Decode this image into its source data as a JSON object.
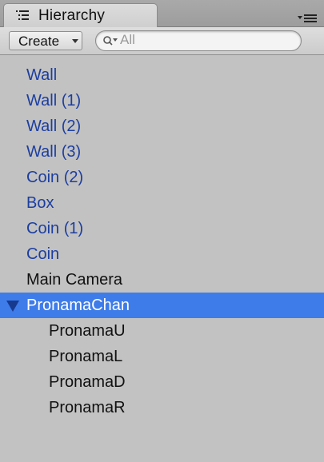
{
  "panel": {
    "tab_title": "Hierarchy",
    "tab_icon": "hierarchy-list-icon",
    "menu_icon": "panel-menu-icon"
  },
  "toolbar": {
    "create_label": "Create",
    "search_placeholder": "All",
    "search_icon": "search-dropdown-icon"
  },
  "tree": {
    "items": [
      {
        "label": "Wall",
        "kind": "prefab",
        "depth": 0
      },
      {
        "label": "Wall (1)",
        "kind": "prefab",
        "depth": 0
      },
      {
        "label": "Wall (2)",
        "kind": "prefab",
        "depth": 0
      },
      {
        "label": "Wall (3)",
        "kind": "prefab",
        "depth": 0
      },
      {
        "label": "Coin (2)",
        "kind": "prefab",
        "depth": 0
      },
      {
        "label": "Box",
        "kind": "prefab",
        "depth": 0
      },
      {
        "label": "Coin (1)",
        "kind": "prefab",
        "depth": 0
      },
      {
        "label": "Coin",
        "kind": "prefab",
        "depth": 0
      },
      {
        "label": "Main Camera",
        "kind": "plain",
        "depth": 0
      },
      {
        "label": "PronamaChan",
        "kind": "selected",
        "depth": 0,
        "expanded": true
      },
      {
        "label": "PronamaU",
        "kind": "plain",
        "depth": 1
      },
      {
        "label": "PronamaL",
        "kind": "plain",
        "depth": 1
      },
      {
        "label": "PronamaD",
        "kind": "plain",
        "depth": 1
      },
      {
        "label": "PronamaR",
        "kind": "plain",
        "depth": 1
      }
    ]
  },
  "colors": {
    "selection": "#3e7ce9",
    "prefab_text": "#1c3ea0",
    "background": "#c2c2c2"
  }
}
